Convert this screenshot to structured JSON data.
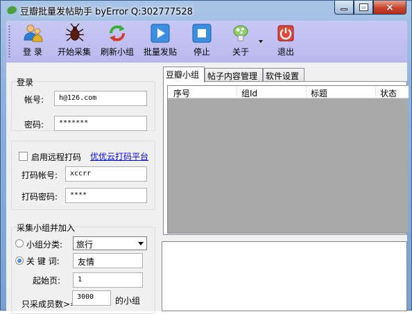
{
  "window": {
    "title": "豆瓣批量发帖助手 byError Q:302777528",
    "minimize": "minimize",
    "maximize": "maximize",
    "close": "×"
  },
  "toolbar": {
    "items": [
      {
        "label": "登 录",
        "icon": "login-users-icon"
      },
      {
        "label": "开始采集",
        "icon": "bug-icon"
      },
      {
        "label": "刷新小组",
        "icon": "refresh-icon"
      },
      {
        "label": "批量发贴",
        "icon": "play-icon"
      },
      {
        "label": "停止",
        "icon": "stop-icon"
      },
      {
        "label": "关于",
        "icon": "about-icon"
      },
      {
        "label": "退出",
        "icon": "exit-icon"
      }
    ]
  },
  "login": {
    "title": "登录",
    "account_label": "帐号:",
    "account_value": "h@126.com",
    "password_label": "密码:",
    "password_value": "*******"
  },
  "remote_captcha": {
    "checkbox_label": "启用远程打码",
    "link": "优优云打码平台",
    "account_label": "打码帐号:",
    "account_value": "xccrr",
    "password_label": "打码密码:",
    "password_value": "****"
  },
  "collect": {
    "title": "采集小组并加入",
    "category_label": "小组分类:",
    "category_value": "旅行",
    "keyword_label": "关 键 词:",
    "keyword_value": "友情",
    "start_page_label": "起始页:",
    "start_page_value": "1",
    "min_members_label": "只采成员数>=",
    "min_members_value": "3000",
    "min_members_suffix": "的小组"
  },
  "tabs": [
    "豆瓣小组",
    "帖子内容管理",
    "软件设置"
  ],
  "grid": {
    "columns": [
      "序号",
      "组Id",
      "标题",
      "状态"
    ]
  },
  "colors": {
    "toolbar_bg": "#c8c8f4",
    "grid_bg": "#a9a9a9",
    "link": "#0000ee"
  }
}
